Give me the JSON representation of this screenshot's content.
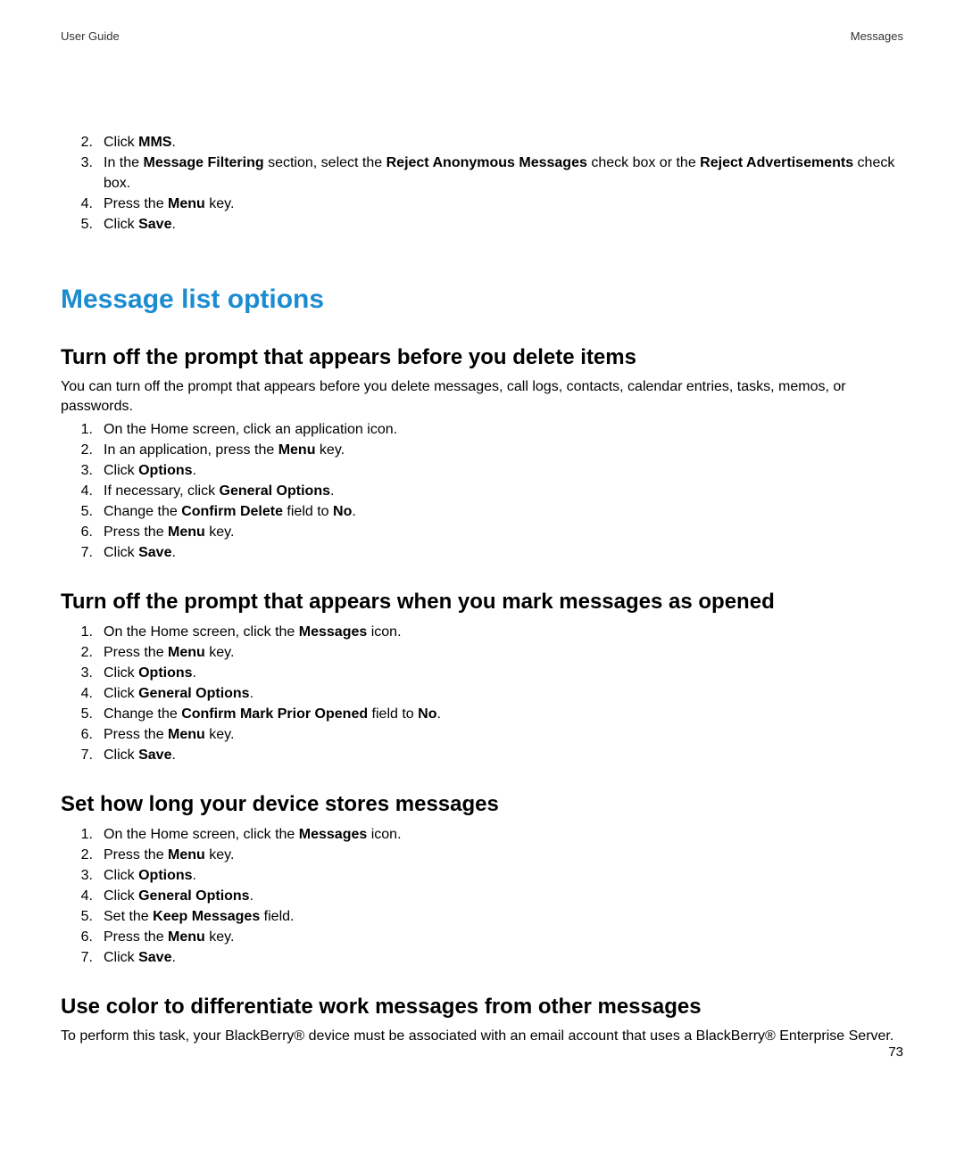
{
  "header": {
    "left": "User Guide",
    "right": "Messages"
  },
  "topSteps": [
    {
      "num": "2.",
      "html": "Click <b>MMS</b>."
    },
    {
      "num": "3.",
      "html": "In the <b>Message Filtering</b> section, select the <b>Reject Anonymous Messages</b> check box or the <b>Reject Advertisements</b> check box."
    },
    {
      "num": "4.",
      "html": "Press the <b>Menu</b> key."
    },
    {
      "num": "5.",
      "html": "Click <b>Save</b>."
    }
  ],
  "h1": "Message list options",
  "sections": [
    {
      "title": "Turn off the prompt that appears before you delete items",
      "intro": "You can turn off the prompt that appears before you delete messages, call logs, contacts, calendar entries, tasks, memos, or passwords.",
      "steps": [
        {
          "num": "1.",
          "html": "On the Home screen, click an application icon."
        },
        {
          "num": "2.",
          "html": "In an application, press the <b>Menu</b> key."
        },
        {
          "num": "3.",
          "html": "Click <b>Options</b>."
        },
        {
          "num": "4.",
          "html": "If necessary, click <b>General Options</b>."
        },
        {
          "num": "5.",
          "html": "Change the <b>Confirm Delete</b> field to <b>No</b>."
        },
        {
          "num": "6.",
          "html": "Press the <b>Menu</b> key."
        },
        {
          "num": "7.",
          "html": "Click <b>Save</b>."
        }
      ]
    },
    {
      "title": "Turn off the prompt that appears when you mark messages as opened",
      "intro": null,
      "steps": [
        {
          "num": "1.",
          "html": "On the Home screen, click the <b>Messages</b> icon."
        },
        {
          "num": "2.",
          "html": "Press the <b>Menu</b> key."
        },
        {
          "num": "3.",
          "html": "Click <b>Options</b>."
        },
        {
          "num": "4.",
          "html": "Click <b>General Options</b>."
        },
        {
          "num": "5.",
          "html": "Change the <b>Confirm Mark Prior Opened</b> field to <b>No</b>."
        },
        {
          "num": "6.",
          "html": "Press the <b>Menu</b> key."
        },
        {
          "num": "7.",
          "html": "Click <b>Save</b>."
        }
      ]
    },
    {
      "title": "Set how long your device stores messages",
      "intro": null,
      "steps": [
        {
          "num": "1.",
          "html": "On the Home screen, click the <b>Messages</b> icon."
        },
        {
          "num": "2.",
          "html": "Press the <b>Menu</b> key."
        },
        {
          "num": "3.",
          "html": "Click <b>Options</b>."
        },
        {
          "num": "4.",
          "html": "Click <b>General Options</b>."
        },
        {
          "num": "5.",
          "html": "Set the <b>Keep Messages</b> field."
        },
        {
          "num": "6.",
          "html": "Press the <b>Menu</b> key."
        },
        {
          "num": "7.",
          "html": "Click <b>Save</b>."
        }
      ]
    },
    {
      "title": "Use color to differentiate work messages from other messages",
      "intro": "To perform this task, your BlackBerry® device must be associated with an email account that uses a BlackBerry® Enterprise Server.",
      "steps": []
    }
  ],
  "pageNumber": "73"
}
